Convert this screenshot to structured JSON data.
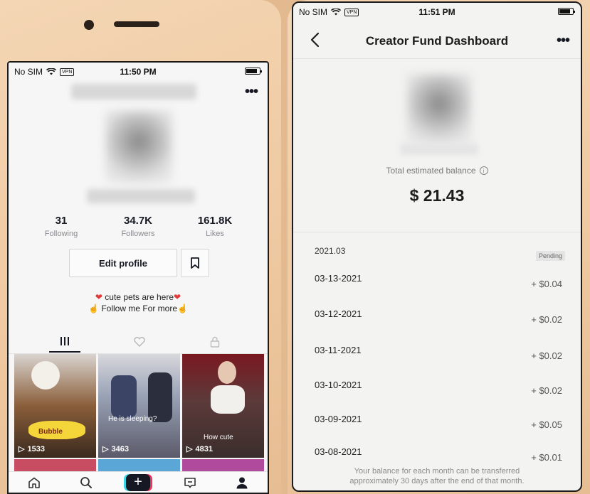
{
  "left_phone": {
    "status": {
      "carrier": "No SIM",
      "vpn": "VPN",
      "time": "11:50 PM",
      "battery_level": 0.85
    },
    "stats": [
      {
        "value": "31",
        "label": "Following"
      },
      {
        "value": "34.7K",
        "label": "Followers"
      },
      {
        "value": "161.8K",
        "label": "Likes"
      }
    ],
    "edit_profile_label": "Edit profile",
    "bio": {
      "line1": "cute pets are here",
      "line2": "Follow me For more"
    },
    "videos": [
      {
        "views": "1533",
        "caption": "Bubble"
      },
      {
        "views": "3463",
        "caption": "He is sleeping?"
      },
      {
        "views": "4831",
        "caption": "How cute"
      }
    ],
    "nav": [
      "home-icon",
      "search-icon",
      "create-icon",
      "inbox-icon",
      "profile-icon"
    ]
  },
  "right_phone": {
    "status": {
      "carrier": "No SIM",
      "vpn": "VPN",
      "time": "11:51 PM",
      "battery_level": 0.85
    },
    "title": "Creator Fund Dashboard",
    "balance_label": "Total estimated balance",
    "balance": "$ 21.43",
    "month": "2021.03",
    "pending_label": "Pending",
    "rows": [
      {
        "date": "03-13-2021",
        "amount": "+ $0.04"
      },
      {
        "date": "03-12-2021",
        "amount": "+ $0.02"
      },
      {
        "date": "03-11-2021",
        "amount": "+ $0.02"
      },
      {
        "date": "03-10-2021",
        "amount": "+ $0.02"
      },
      {
        "date": "03-09-2021",
        "amount": "+ $0.05"
      },
      {
        "date": "03-08-2021",
        "amount": "+ $0.01"
      }
    ],
    "footnote_line1": "Your balance for each month can be transferred",
    "footnote_line2": "approximately 30 days after the end of that month."
  },
  "colors": {
    "accent_dark": "#161823",
    "cyan": "#3ad5e0",
    "pink": "#f0325c",
    "heart": "#e03b3b"
  }
}
